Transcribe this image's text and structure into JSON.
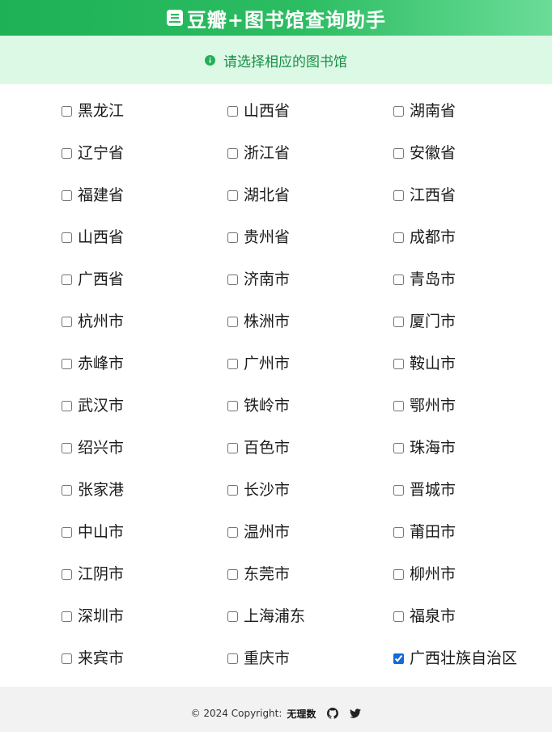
{
  "header": {
    "title": "豆瓣+图书馆查询助手",
    "brand_color": "#1fb155"
  },
  "notice": {
    "text": "请选择相应的图书馆",
    "icon": "info-icon"
  },
  "libraries": [
    {
      "label": "黑龙江",
      "checked": false
    },
    {
      "label": "山西省",
      "checked": false
    },
    {
      "label": "湖南省",
      "checked": false
    },
    {
      "label": "辽宁省",
      "checked": false
    },
    {
      "label": "浙江省",
      "checked": false
    },
    {
      "label": "安徽省",
      "checked": false
    },
    {
      "label": "福建省",
      "checked": false
    },
    {
      "label": "湖北省",
      "checked": false
    },
    {
      "label": "江西省",
      "checked": false
    },
    {
      "label": "山西省",
      "checked": false
    },
    {
      "label": "贵州省",
      "checked": false
    },
    {
      "label": "成都市",
      "checked": false
    },
    {
      "label": "广西省",
      "checked": false
    },
    {
      "label": "济南市",
      "checked": false
    },
    {
      "label": "青岛市",
      "checked": false
    },
    {
      "label": "杭州市",
      "checked": false
    },
    {
      "label": "株洲市",
      "checked": false
    },
    {
      "label": "厦门市",
      "checked": false
    },
    {
      "label": "赤峰市",
      "checked": false
    },
    {
      "label": "广州市",
      "checked": false
    },
    {
      "label": "鞍山市",
      "checked": false
    },
    {
      "label": "武汉市",
      "checked": false
    },
    {
      "label": "铁岭市",
      "checked": false
    },
    {
      "label": "鄂州市",
      "checked": false
    },
    {
      "label": "绍兴市",
      "checked": false
    },
    {
      "label": "百色市",
      "checked": false
    },
    {
      "label": "珠海市",
      "checked": false
    },
    {
      "label": "张家港",
      "checked": false
    },
    {
      "label": "长沙市",
      "checked": false
    },
    {
      "label": "晋城市",
      "checked": false
    },
    {
      "label": "中山市",
      "checked": false
    },
    {
      "label": "温州市",
      "checked": false
    },
    {
      "label": "莆田市",
      "checked": false
    },
    {
      "label": "江阴市",
      "checked": false
    },
    {
      "label": "东莞市",
      "checked": false
    },
    {
      "label": "柳州市",
      "checked": false
    },
    {
      "label": "深圳市",
      "checked": false
    },
    {
      "label": "上海浦东",
      "checked": false
    },
    {
      "label": "福泉市",
      "checked": false
    },
    {
      "label": "来宾市",
      "checked": false
    },
    {
      "label": "重庆市",
      "checked": false
    },
    {
      "label": "广西壮族自治区",
      "checked": true
    }
  ],
  "footer": {
    "copyright": "© 2024 Copyright:",
    "author": "无理数",
    "icons": [
      "github-icon",
      "twitter-icon"
    ]
  }
}
